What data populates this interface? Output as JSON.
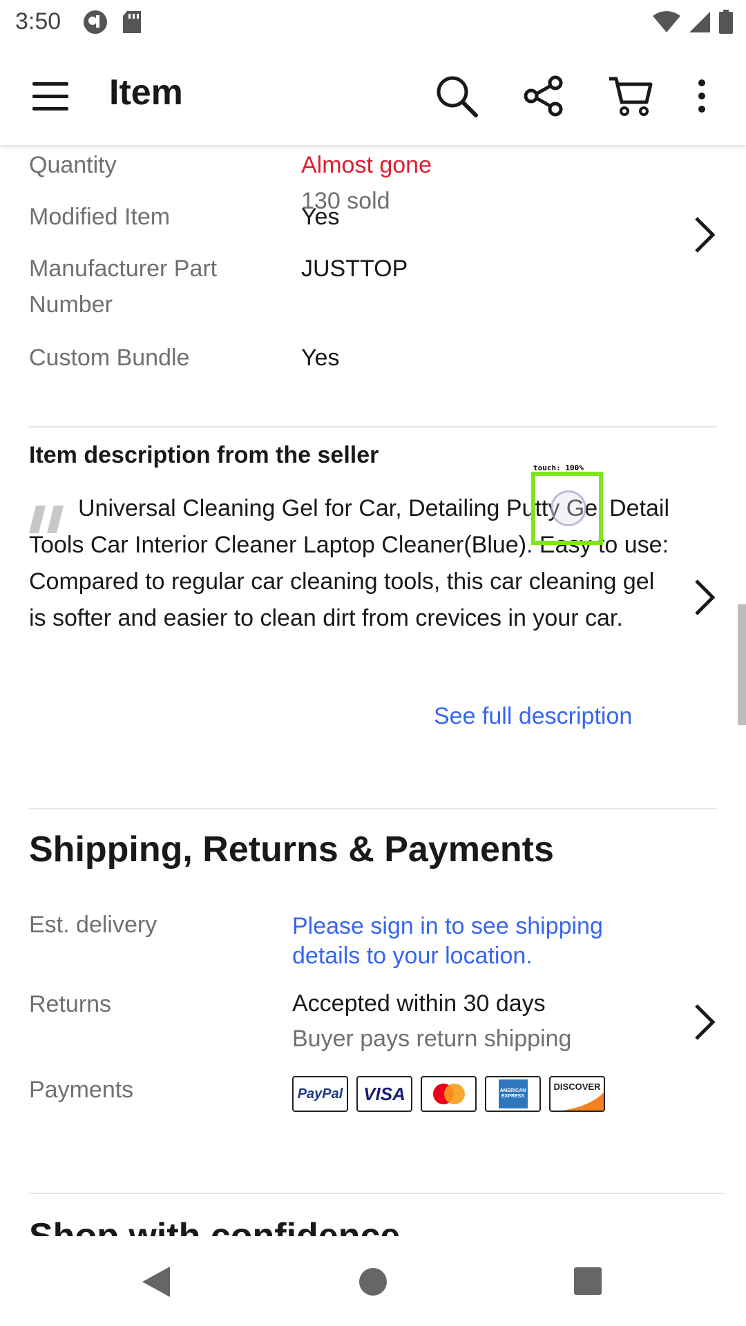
{
  "status_bar": {
    "time": "3:50"
  },
  "app_bar": {
    "title": "Item"
  },
  "specs": [
    {
      "label": "Quantity",
      "value": "Almost gone",
      "sub": "130 sold"
    },
    {
      "label": "Modified Item",
      "value": "Yes"
    },
    {
      "label": "Manufacturer Part Number",
      "value": "JUSTTOP"
    },
    {
      "label": "Custom Bundle",
      "value": "Yes"
    }
  ],
  "description": {
    "heading": "Item description from the seller",
    "text": "Universal Cleaning Gel for Car, Detailing Putty Gel Detail Tools Car Interior Cleaner Laptop Cleaner(Blue). Easy to use: Compared to regular car cleaning tools, this car cleaning gel is softer and easier to clean dirt from crevices in your car.",
    "see_full": "See full description"
  },
  "shipping": {
    "title": "Shipping, Returns & Payments",
    "est_delivery_label": "Est. delivery",
    "est_delivery_value": "Please sign in to see shipping details to your location.",
    "returns_label": "Returns",
    "returns_value": "Accepted within 30 days",
    "returns_sub": "Buyer pays return shipping",
    "payments_label": "Payments",
    "payment_methods": [
      "PayPal",
      "VISA",
      "Mastercard",
      "AMERICAN EXPRESS",
      "DISCOVER"
    ]
  },
  "next_section": {
    "title": "Shop with confidence"
  },
  "touch_overlay": {
    "label": "touch: 100%"
  },
  "colors": {
    "accent_red": "#dd1e31",
    "link_blue": "#3665f3",
    "label_gray": "#707070"
  }
}
